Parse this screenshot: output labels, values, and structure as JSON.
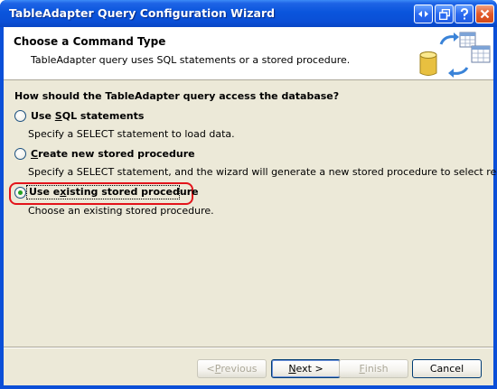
{
  "window": {
    "title": "TableAdapter Query Configuration Wizard",
    "titlebar_buttons": [
      "help-toggle",
      "restore",
      "help",
      "close"
    ]
  },
  "header": {
    "title": "Choose a Command Type",
    "subtitle": "TableAdapter query uses SQL statements or a stored procedure.",
    "icon": "database-table-transfer-icon"
  },
  "question": "How should the TableAdapter query access the database?",
  "options": [
    {
      "label_prefix": "Use ",
      "label_accel": "S",
      "label_rest": "QL statements",
      "description": "Specify a SELECT statement to load data.",
      "selected": false
    },
    {
      "label_prefix": "",
      "label_accel": "C",
      "label_rest": "reate new stored procedure",
      "description": "Specify a SELECT statement, and the wizard will generate a new stored procedure to select records.",
      "selected": false
    },
    {
      "label_prefix": "Use e",
      "label_accel": "x",
      "label_rest": "isting stored procedure",
      "description": "Choose an existing stored procedure.",
      "selected": true
    }
  ],
  "buttons": {
    "previous_prefix": "< ",
    "previous_accel": "P",
    "previous_rest": "revious",
    "next_accel": "N",
    "next_rest": "ext >",
    "finish_accel": "F",
    "finish_rest": "inish",
    "cancel": "Cancel"
  },
  "colors": {
    "highlight": "#e3141b",
    "radio_dot": "#21a121",
    "titlebar": "#0a55dc"
  }
}
